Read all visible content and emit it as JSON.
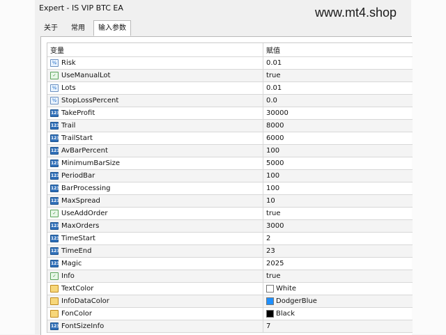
{
  "window": {
    "title": "Expert - IS VIP BTC EA"
  },
  "watermark": "www.mt4.shop",
  "tabs": [
    {
      "label": "关于"
    },
    {
      "label": "常用"
    },
    {
      "label": "输入参数",
      "active": true
    }
  ],
  "table": {
    "headers": {
      "variable": "变量",
      "value": "赋值"
    },
    "rows": [
      {
        "name": "Risk",
        "value": "0.01",
        "icon": "double-icon"
      },
      {
        "name": "UseManualLot",
        "value": "true",
        "icon": "bool-icon"
      },
      {
        "name": "Lots",
        "value": "0.01",
        "icon": "double-icon"
      },
      {
        "name": "StopLossPercent",
        "value": "0.0",
        "icon": "double-icon"
      },
      {
        "name": "TakeProfit",
        "value": "30000",
        "icon": "integer-icon"
      },
      {
        "name": "Trail",
        "value": "8000",
        "icon": "integer-icon"
      },
      {
        "name": "TrailStart",
        "value": "6000",
        "icon": "integer-icon"
      },
      {
        "name": "AvBarPercent",
        "value": "100",
        "icon": "integer-icon"
      },
      {
        "name": "MinimumBarSize",
        "value": "5000",
        "icon": "integer-icon"
      },
      {
        "name": "PeriodBar",
        "value": "100",
        "icon": "integer-icon"
      },
      {
        "name": "BarProcessing",
        "value": "100",
        "icon": "integer-icon"
      },
      {
        "name": "MaxSpread",
        "value": "10",
        "icon": "integer-icon"
      },
      {
        "name": "UseAddOrder",
        "value": "true",
        "icon": "bool-icon"
      },
      {
        "name": "MaxOrders",
        "value": "3000",
        "icon": "integer-icon"
      },
      {
        "name": "TimeStart",
        "value": "2",
        "icon": "integer-icon"
      },
      {
        "name": "TimeEnd",
        "value": "23",
        "icon": "integer-icon"
      },
      {
        "name": "Magic",
        "value": "2025",
        "icon": "integer-icon"
      },
      {
        "name": "Info",
        "value": "true",
        "icon": "bool-icon"
      },
      {
        "name": "TextColor",
        "value": "White",
        "icon": "color-icon",
        "swatch": "#ffffff"
      },
      {
        "name": "InfoDataColor",
        "value": "DodgerBlue",
        "icon": "color-icon",
        "swatch": "#1e90ff"
      },
      {
        "name": "FonColor",
        "value": "Black",
        "icon": "color-icon",
        "swatch": "#000000"
      },
      {
        "name": "FontSizeInfo",
        "value": "7",
        "icon": "integer-icon"
      }
    ]
  }
}
